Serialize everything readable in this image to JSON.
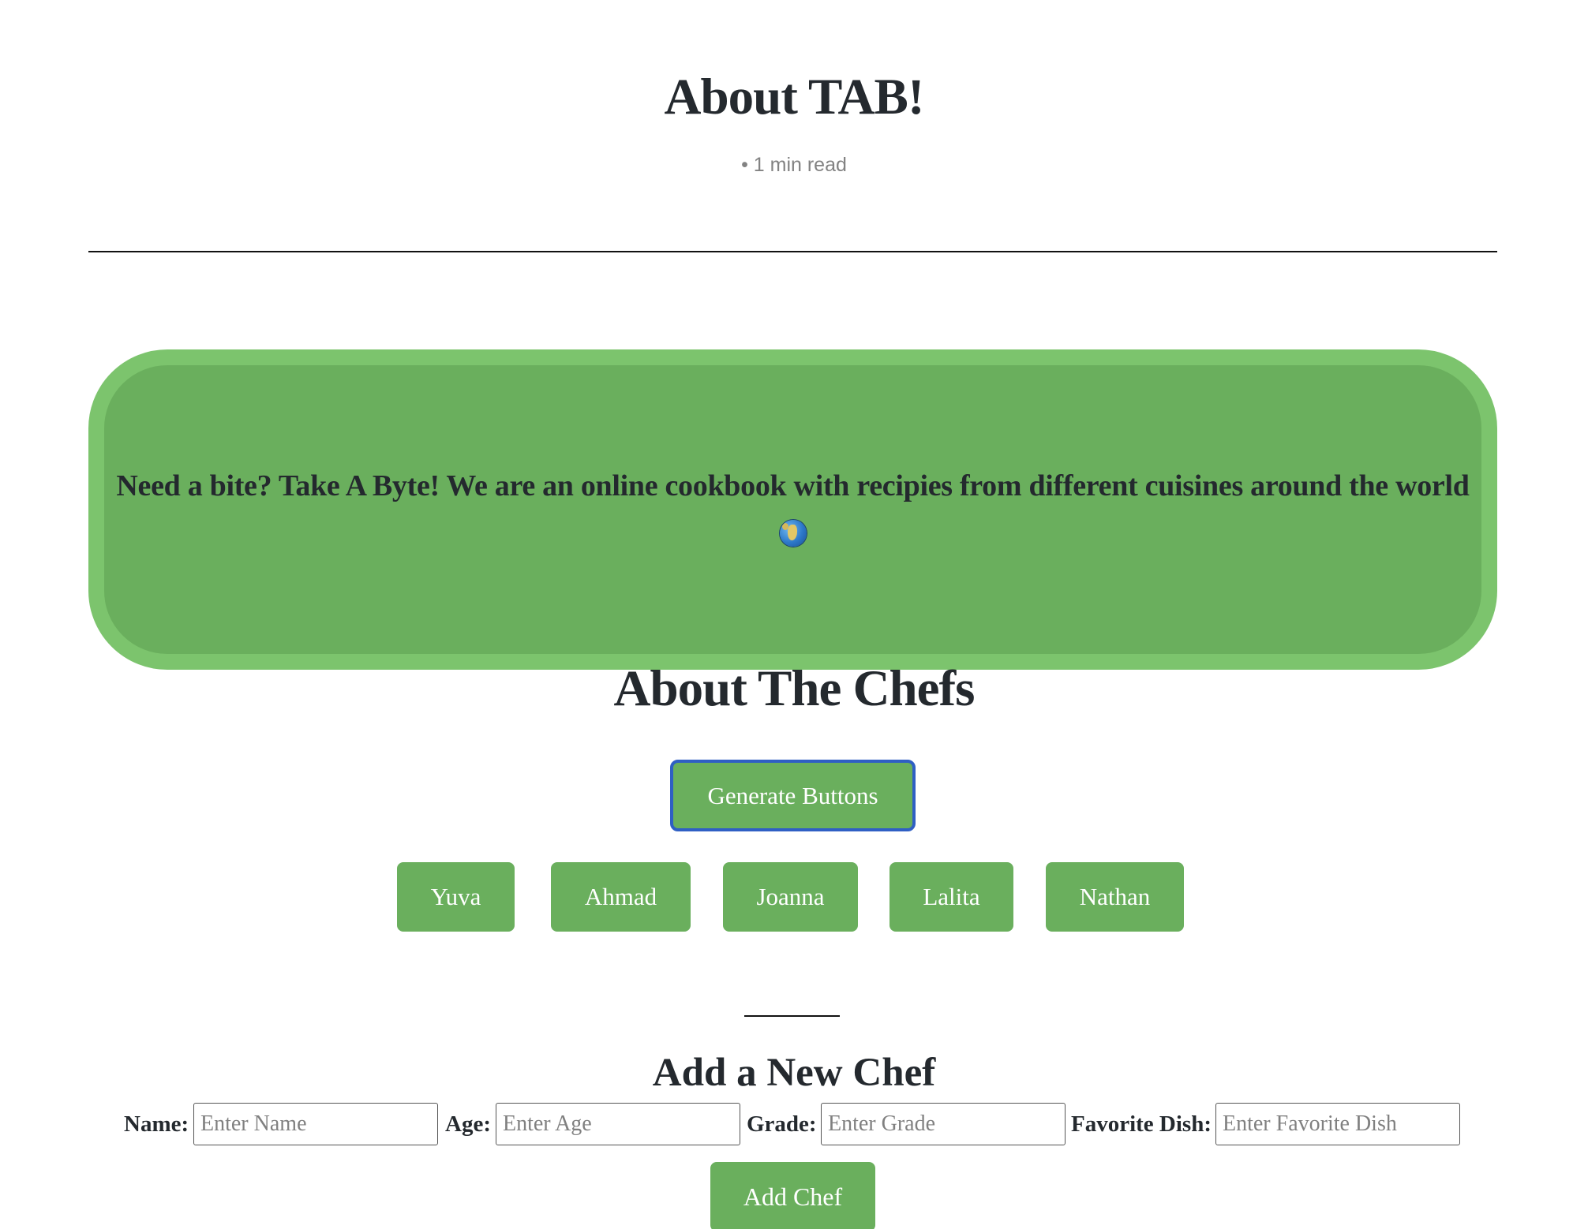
{
  "page": {
    "title": "About TAB!",
    "read_time": "• 1 min read"
  },
  "banner": {
    "text": "Need a bite? Take A Byte! We are an online cookbook with recipies from different cuisines around the world",
    "icon": "globe-icon"
  },
  "chefs": {
    "title": "About The Chefs",
    "generate_label": "Generate Buttons",
    "names": [
      "Yuva",
      "Ahmad",
      "Joanna",
      "Lalita",
      "Nathan"
    ]
  },
  "form": {
    "title": "Add a New Chef",
    "name_label": "Name:",
    "name_placeholder": "Enter Name",
    "age_label": "Age:",
    "age_placeholder": "Enter Age",
    "grade_label": "Grade:",
    "grade_placeholder": "Enter Grade",
    "dish_label": "Favorite Dish:",
    "dish_placeholder": "Enter Favorite Dish",
    "submit_label": "Add Chef"
  },
  "colors": {
    "accent_green": "#6aaf5d",
    "banner_border": "#7cc46d",
    "focus_outline": "#2f5fc4",
    "text": "#24292e",
    "muted_text": "#828282"
  }
}
